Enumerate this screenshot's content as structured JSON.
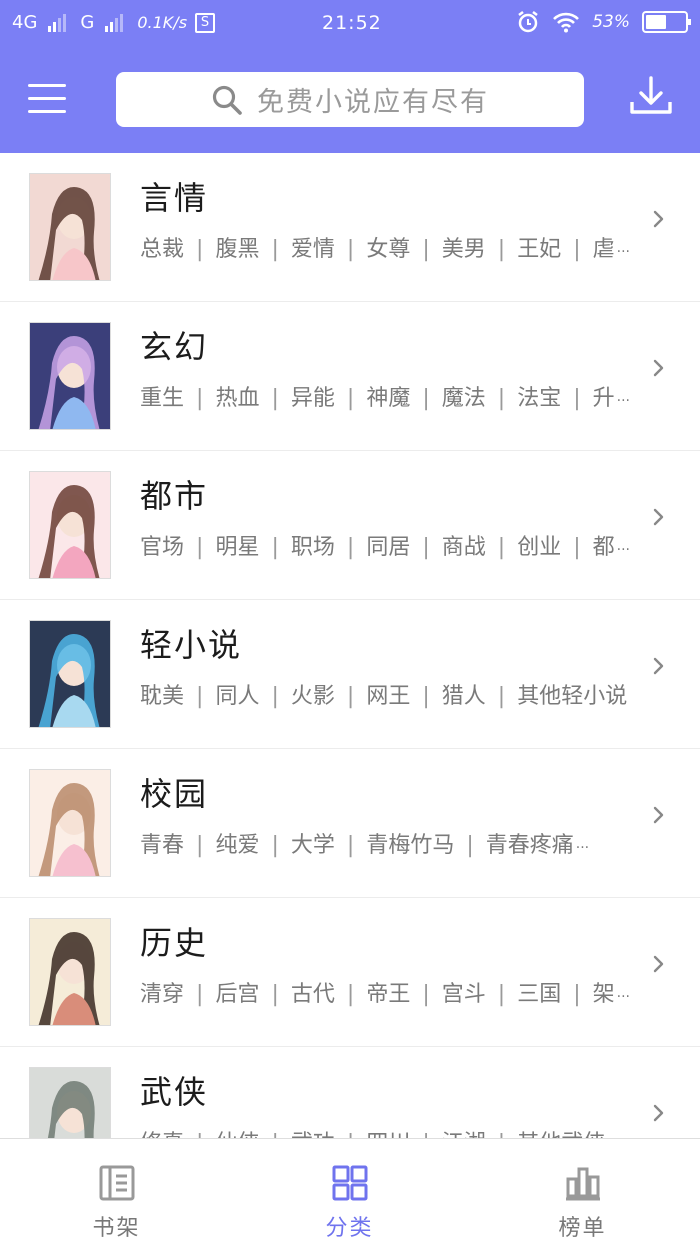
{
  "status_bar": {
    "network1": "4G",
    "network2": "G",
    "speed": "0.1K/s",
    "s_badge": "S",
    "time": "21:52",
    "battery": "53%",
    "battery_level": 0.53
  },
  "colors": {
    "header": "#7b7ff5",
    "accent": "#6f73ee"
  },
  "search": {
    "placeholder": "免费小说应有尽有"
  },
  "icons": {
    "menu": "menu-icon",
    "search": "search-icon",
    "download": "download-icon",
    "chevron": "chevron-right-icon"
  },
  "categories": [
    {
      "title": "言情",
      "tags": [
        "总裁",
        "腹黑",
        "爱情",
        "女尊",
        "美男",
        "王妃",
        "虐"
      ],
      "more": "···"
    },
    {
      "title": "玄幻",
      "tags": [
        "重生",
        "热血",
        "异能",
        "神魔",
        "魔法",
        "法宝",
        "升"
      ],
      "more": "···"
    },
    {
      "title": "都市",
      "tags": [
        "官场",
        "明星",
        "职场",
        "同居",
        "商战",
        "创业",
        "都"
      ],
      "more": "···"
    },
    {
      "title": "轻小说",
      "tags": [
        "耽美",
        "同人",
        "火影",
        "网王",
        "猎人",
        "其他轻小说"
      ],
      "more": ""
    },
    {
      "title": "校园",
      "tags": [
        "青春",
        "纯爱",
        "大学",
        "青梅竹马",
        "青春疼痛"
      ],
      "more": "···"
    },
    {
      "title": "历史",
      "tags": [
        "清穿",
        "后宫",
        "古代",
        "帝王",
        "宫斗",
        "三国",
        "架"
      ],
      "more": "···"
    },
    {
      "title": "武侠",
      "tags": [
        "修真",
        "仙侠",
        "武功",
        "四川",
        "江湖",
        "其他武侠"
      ],
      "more": ""
    }
  ],
  "tabs": [
    {
      "label": "书架",
      "icon": "bookshelf-icon",
      "active": false
    },
    {
      "label": "分类",
      "icon": "category-grid-icon",
      "active": true
    },
    {
      "label": "榜单",
      "icon": "ranking-bars-icon",
      "active": false
    }
  ]
}
